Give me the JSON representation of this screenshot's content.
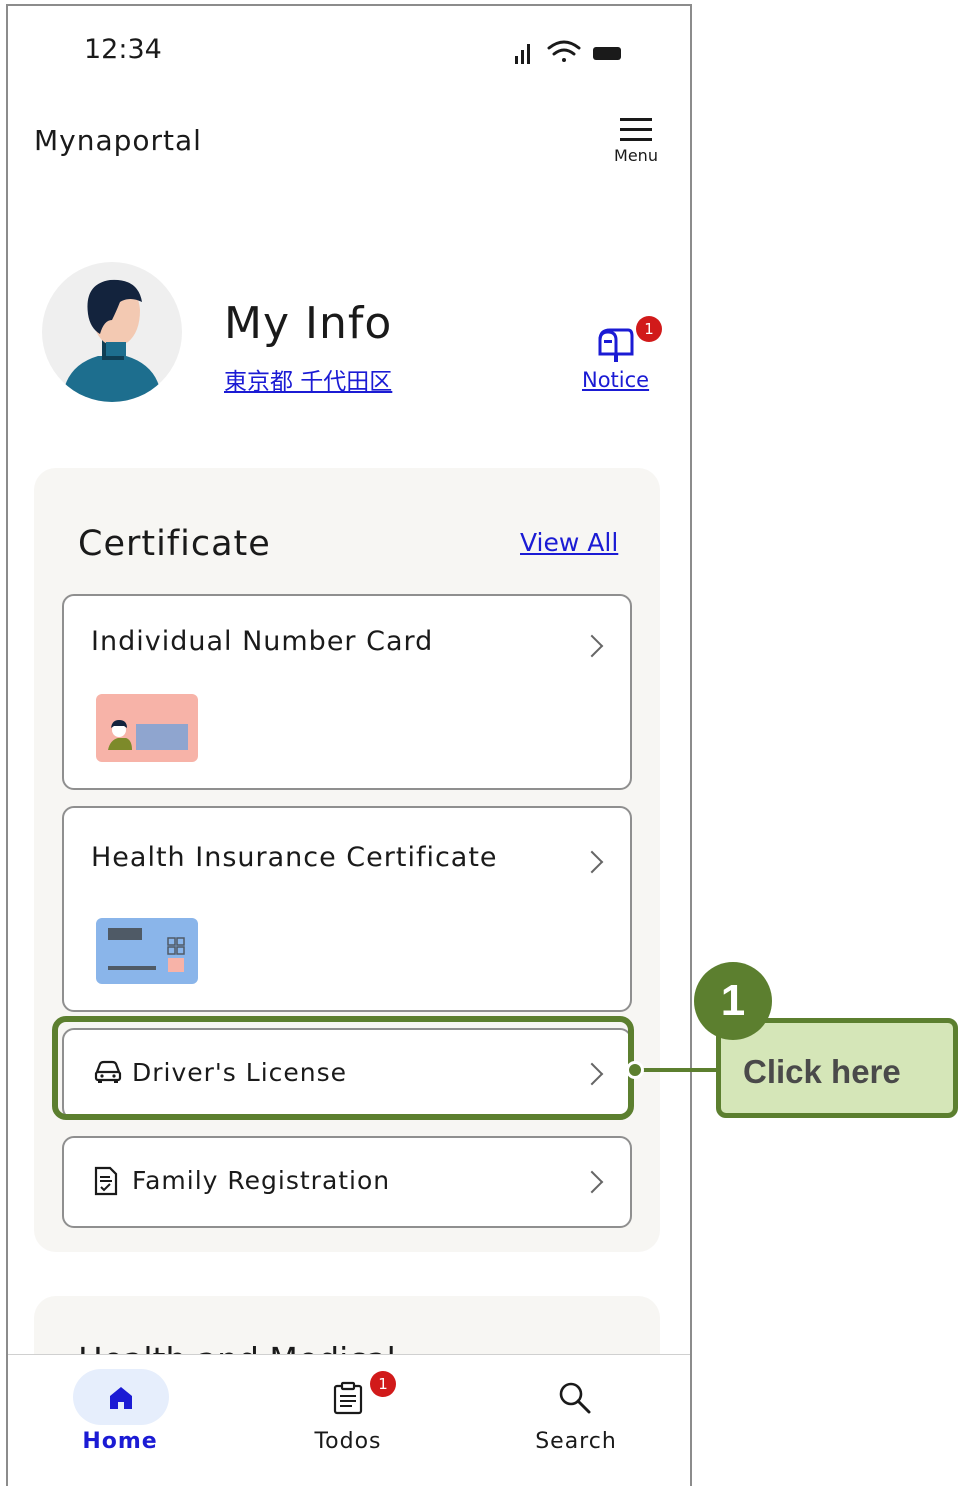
{
  "status_bar": {
    "time": "12:34"
  },
  "header": {
    "app_title": "Mynaportal",
    "menu_label": "Menu"
  },
  "profile": {
    "title": "My Info",
    "location": "東京都 千代田区",
    "notice_label": "Notice",
    "notice_count": "1"
  },
  "certificate": {
    "title": "Certificate",
    "view_all": "View All",
    "items": [
      {
        "label": "Individual Number Card"
      },
      {
        "label": "Health Insurance Certificate"
      },
      {
        "label": "Driver's License"
      },
      {
        "label": "Family Registration"
      }
    ]
  },
  "next_section": {
    "title": "Health and Medical"
  },
  "bottom_nav": [
    {
      "label": "Home"
    },
    {
      "label": "Todos",
      "badge": "1"
    },
    {
      "label": "Search"
    }
  ],
  "annotation": {
    "step": "1",
    "callout": "Click here"
  },
  "colors": {
    "link": "#1b1bd4",
    "badge": "#d11a1a",
    "annotation": "#5c7f2f",
    "callout_bg": "#d5e6b8",
    "home_active": "#1b1bd4"
  }
}
